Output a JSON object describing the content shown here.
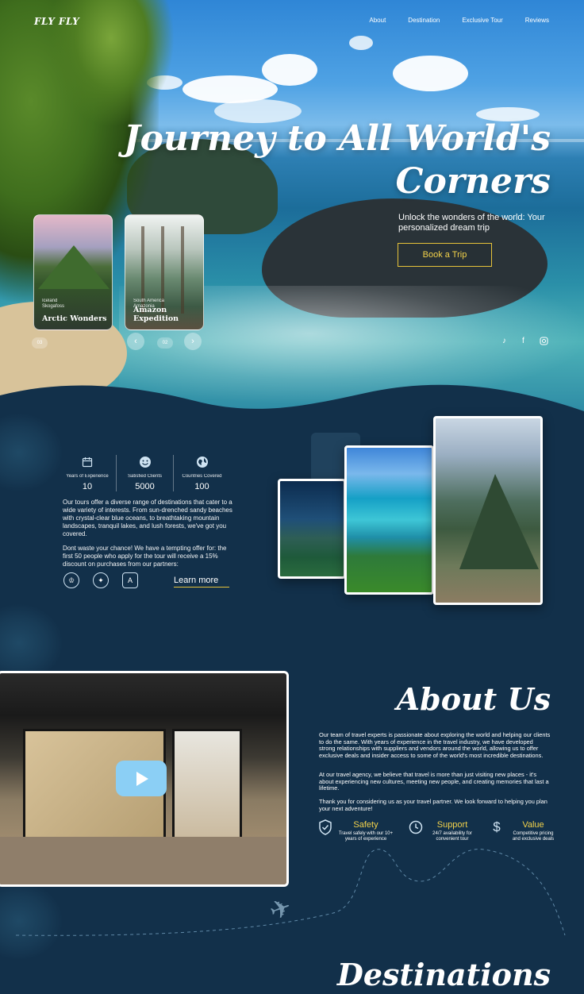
{
  "brand": {
    "logo": "FLY FLY"
  },
  "nav": [
    "About",
    "Destination",
    "Exclusive Tour",
    "Reviews"
  ],
  "hero": {
    "title_line1": "Journey to All World's",
    "title_line2": "Corners",
    "subtitle": "Unlock the wonders of the world: Your personalized dream trip",
    "cta": "Book a Trip",
    "cards": [
      {
        "region": "Iceland",
        "place": "Skogafoss",
        "name": "Arctic Wonders"
      },
      {
        "region": "South America",
        "place": "Amazonia",
        "name": "Amazon Expedition"
      }
    ],
    "pagination": {
      "current": "03",
      "next": "02"
    },
    "social": [
      "tiktok-icon",
      "facebook-icon",
      "instagram-icon"
    ]
  },
  "stats": [
    {
      "icon": "calendar-icon",
      "label": "Years of Experience",
      "value": "10"
    },
    {
      "icon": "smile-icon",
      "label": "Satisfied Clients",
      "value": "5000"
    },
    {
      "icon": "globe-icon",
      "label": "Countries Covered",
      "value": "100"
    }
  ],
  "intro": {
    "p1": "Our tours offer a diverse range of destinations that cater to a wide variety of interests. From sun-drenched sandy beaches with crystal-clear blue oceans, to breathtaking mountain landscapes, tranquil lakes, and lush forests, we've got you covered.",
    "p2": "Dont waste your chance! We have a tempting offer for: the first 50 people who apply for the tour will receive a 15% discount on purchases from our partners:",
    "partners": [
      "crown-badge-icon",
      "star-badge-icon",
      "letter-a-badge-icon"
    ],
    "learn_more": "Learn more"
  },
  "about": {
    "title": "About Us",
    "p1": "Our team of travel experts is passionate about exploring the world and helping our clients to do the same. With years of experience in the travel industry, we have developed strong relationships with suppliers and vendors around the world, allowing us to offer exclusive deals and insider access to some of the world's most incredible destinations.",
    "p2": "At our travel agency, we believe that travel is more than just visiting new places - it's about experiencing new cultures, meeting new people, and creating memories that last a lifetime.",
    "p3": "Thank you for considering us as your travel partner. We look forward to helping you plan your next adventure!",
    "features": [
      {
        "icon": "shield-check-icon",
        "title": "Safety",
        "desc": "Travel safely with our 10+ years of experience"
      },
      {
        "icon": "clock-icon",
        "title": "Support",
        "desc": "24/7 availability for convenient tour"
      },
      {
        "icon": "dollar-icon",
        "title": "Value",
        "desc": "Competitive pricing and exclusive deals"
      }
    ]
  },
  "destinations": {
    "title": "Destinations"
  },
  "colors": {
    "accent": "#e6c23a",
    "background": "#12304a",
    "play": "#8bcff5"
  }
}
